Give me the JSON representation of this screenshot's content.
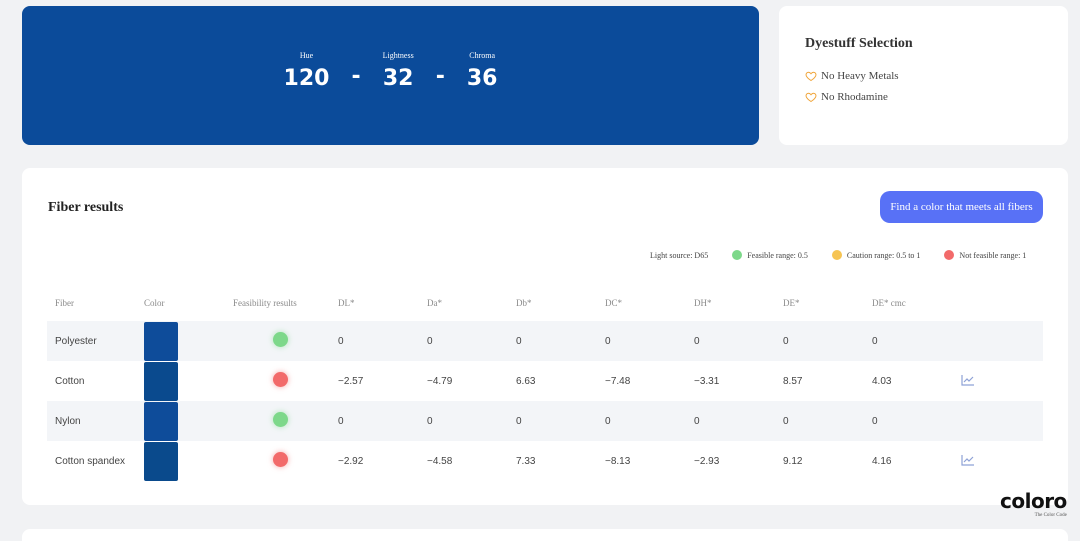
{
  "color": {
    "background": "#0b4b9a",
    "hue_label": "Hue",
    "hue": "120",
    "lightness_label": "Lightness",
    "lightness": "32",
    "chroma_label": "Chroma",
    "chroma": "36",
    "separator": "-"
  },
  "dyestuff": {
    "title": "Dyestuff Selection",
    "items": [
      "No Heavy Metals",
      "No Rhodamine"
    ]
  },
  "fiber_results": {
    "title": "Fiber results",
    "button_label": "Find a color that meets all fibers",
    "light_source": "Light source: D65",
    "legend": [
      {
        "label": "Feasible range: 0.5",
        "color": "#7dd88a"
      },
      {
        "label": "Caution range: 0.5 to 1",
        "color": "#f6c453"
      },
      {
        "label": "Not feasible range: 1",
        "color": "#f26a6a"
      }
    ],
    "columns": [
      "Fiber",
      "Color",
      "Feasibility results",
      "DL*",
      "Da*",
      "Db*",
      "DC*",
      "DH*",
      "DE*",
      "DE* cmc"
    ],
    "rows": [
      {
        "fiber": "Polyester",
        "swatch": "#0e4c9a",
        "status": "green",
        "dl": "0",
        "da": "0",
        "db": "0",
        "dc": "0",
        "dh": "0",
        "de": "0",
        "decmc": "0",
        "chart": false
      },
      {
        "fiber": "Cotton",
        "swatch": "#0a4a8e",
        "status": "red",
        "dl": "−2.57",
        "da": "−4.79",
        "db": "6.63",
        "dc": "−7.48",
        "dh": "−3.31",
        "de": "8.57",
        "decmc": "4.03",
        "chart": true
      },
      {
        "fiber": "Nylon",
        "swatch": "#0e4c9a",
        "status": "green",
        "dl": "0",
        "da": "0",
        "db": "0",
        "dc": "0",
        "dh": "0",
        "de": "0",
        "decmc": "0",
        "chart": false
      },
      {
        "fiber": "Cotton spandex",
        "swatch": "#0a4a8c",
        "status": "red",
        "dl": "−2.92",
        "da": "−4.58",
        "db": "7.33",
        "dc": "−8.13",
        "dh": "−2.93",
        "de": "9.12",
        "decmc": "4.16",
        "chart": true
      }
    ]
  },
  "logo": {
    "text": "coloro",
    "tagline": "The Color Code"
  }
}
